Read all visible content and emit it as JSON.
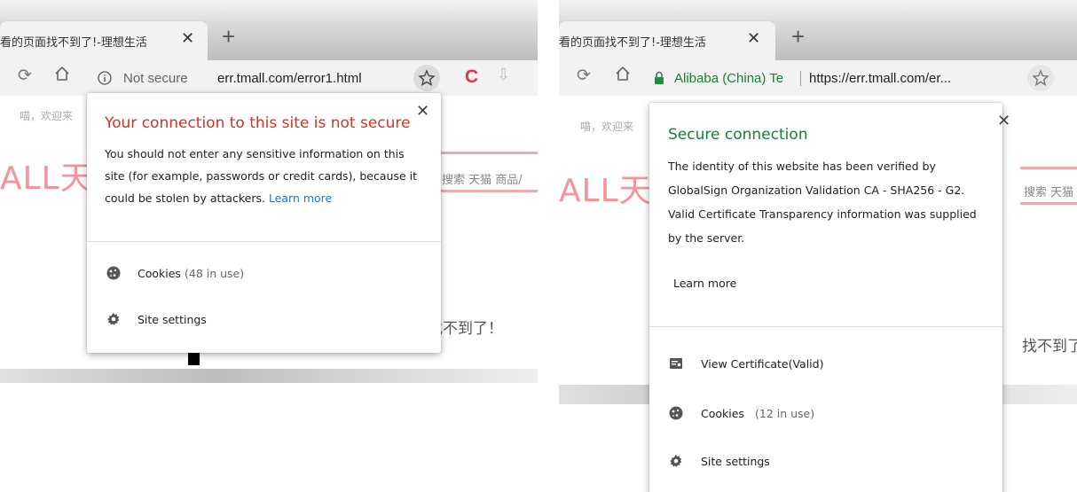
{
  "left": {
    "tab": {
      "title": "看的页面找不到了!-理想生活",
      "close": "✕",
      "new_tab": "+"
    },
    "toolbar": {
      "reload_icon": "reload-icon",
      "home_icon": "home-icon",
      "security_label": "Not secure",
      "url": "err.tmall.com/error1.html",
      "star_icon": "star-icon"
    },
    "page": {
      "welcome": "喵，欢迎来",
      "logo": "ALL天",
      "search": "搜索 天猫 商品/",
      "not_found": "找不到了！"
    },
    "popup": {
      "close": "✕",
      "title": "Your connection to this site is not secure",
      "body": "You should not enter any sensitive information on this site (for example, passwords or credit cards), because it could be stolen by attackers.",
      "learn_more": "Learn more",
      "cookies_label": "Cookies",
      "cookies_count": "(48 in use)",
      "site_settings_label": "Site settings"
    },
    "colors": {
      "title": "#d93025"
    }
  },
  "right": {
    "tab": {
      "title": "看的页面找不到了!-理想生活",
      "close": "✕",
      "new_tab": "+"
    },
    "toolbar": {
      "reload_icon": "reload-icon",
      "home_icon": "home-icon",
      "owner": "Alibaba (China) Te",
      "url": "https://err.tmall.com/er...",
      "star_icon": "star-icon"
    },
    "page": {
      "welcome": "喵，欢迎来",
      "logo": "ALL天",
      "search": "搜索 天猫",
      "not_found": "找不到了"
    },
    "popup": {
      "close": "✕",
      "title": "Secure connection",
      "body": "The identity of this website has been verified by GlobalSign Organization Validation CA - SHA256 - G2. Valid Certificate Transparency information was supplied by the server.",
      "learn_more": "Learn more",
      "certificate_label": "View Certificate",
      "certificate_status": "(Valid)",
      "cookies_label": "Cookies",
      "cookies_count": "(12 in use)",
      "site_settings_label": "Site settings"
    },
    "colors": {
      "title": "#188038",
      "lock": "#1e8e3e"
    }
  }
}
